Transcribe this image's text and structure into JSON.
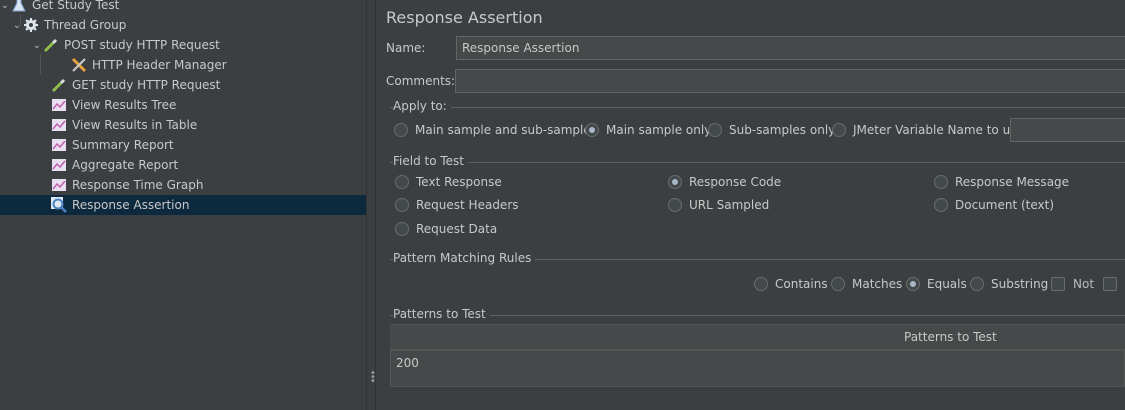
{
  "tree": {
    "items": [
      {
        "label": "Get Study Test"
      },
      {
        "label": "Thread Group"
      },
      {
        "label": "POST study HTTP Request"
      },
      {
        "label": "HTTP Header Manager"
      },
      {
        "label": "GET study HTTP Request"
      },
      {
        "label": "View Results Tree"
      },
      {
        "label": "View Results in Table"
      },
      {
        "label": "Summary Report"
      },
      {
        "label": "Aggregate Report"
      },
      {
        "label": "Response Time Graph"
      },
      {
        "label": "Response Assertion"
      }
    ],
    "selected_index": 10
  },
  "panel": {
    "title": "Response Assertion",
    "name_label": "Name:",
    "name_value": "Response Assertion",
    "comments_label": "Comments:",
    "comments_value": ""
  },
  "apply_to": {
    "title": "Apply to:",
    "options": [
      "Main sample and sub-samples",
      "Main sample only",
      "Sub-samples only",
      "JMeter Variable Name to use"
    ],
    "selected": "Main sample only",
    "variable_value": ""
  },
  "field_to_test": {
    "title": "Field to Test",
    "options": [
      "Text Response",
      "Response Code",
      "Response Message",
      "Request Headers",
      "URL Sampled",
      "Document (text)",
      "Request Data"
    ],
    "selected": "Response Code"
  },
  "pattern_rules": {
    "title": "Pattern Matching Rules",
    "options": [
      "Contains",
      "Matches",
      "Equals",
      "Substring"
    ],
    "selected": "Equals",
    "not_label": "Not",
    "not_checked": false
  },
  "patterns": {
    "title": "Patterns to Test",
    "column_header": "Patterns to Test",
    "rows": [
      "200"
    ]
  },
  "colors": {
    "background": "#3c3f41",
    "selection": "#0d293e",
    "text": "#c8c8c8"
  }
}
